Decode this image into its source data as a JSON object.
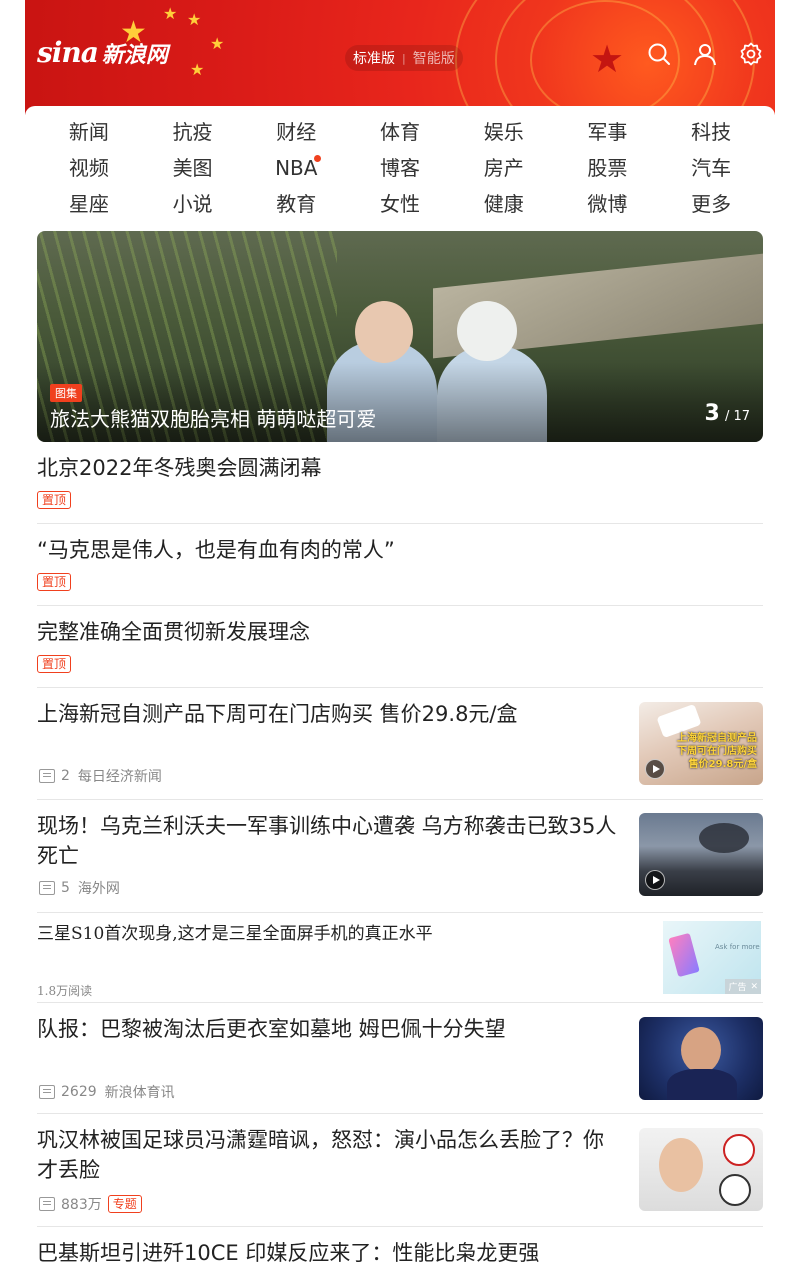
{
  "header": {
    "logo_eye": "sina",
    "logo_text": "新浪网",
    "version_standard": "标准版",
    "version_separator": "|",
    "version_smart": "智能版",
    "icons": [
      "search-icon",
      "user-icon",
      "settings-icon"
    ]
  },
  "nav": {
    "items": [
      {
        "label": "新闻"
      },
      {
        "label": "抗疫"
      },
      {
        "label": "财经"
      },
      {
        "label": "体育"
      },
      {
        "label": "娱乐"
      },
      {
        "label": "军事"
      },
      {
        "label": "科技"
      },
      {
        "label": "视频"
      },
      {
        "label": "美图"
      },
      {
        "label": "NBA",
        "dot": true
      },
      {
        "label": "博客"
      },
      {
        "label": "房产"
      },
      {
        "label": "股票"
      },
      {
        "label": "汽车"
      },
      {
        "label": "星座"
      },
      {
        "label": "小说"
      },
      {
        "label": "教育"
      },
      {
        "label": "女性"
      },
      {
        "label": "健康"
      },
      {
        "label": "微博"
      },
      {
        "label": "更多"
      }
    ]
  },
  "hero": {
    "tag": "图集",
    "caption": "旅法大熊猫双胞胎亮相 萌萌哒超可爱",
    "current": "3",
    "total": "/ 17"
  },
  "news": [
    {
      "title": "北京2022年冬残奥会圆满闭幕",
      "pin": "置顶"
    },
    {
      "title": "“马克思是伟人，也是有血有肉的常人”",
      "pin": "置顶"
    },
    {
      "title": "完整准确全面贯彻新发展理念",
      "pin": "置顶"
    },
    {
      "title": "上海新冠自测产品下周可在门店购买 售价29.8元/盒",
      "comments": "2",
      "source": "每日经济新闻",
      "thumb_text_1": "上海新冠自测产品",
      "thumb_text_2": "下周可在门店购买",
      "thumb_text_3": "售价29.8元/盒"
    },
    {
      "title": "现场！乌克兰利沃夫一军事训练中心遭袭 乌方称袭击已致35人死亡",
      "comments": "5",
      "source": "海外网"
    },
    {
      "title": "三星S10首次现身,这才是三星全面屏手机的真正水平",
      "reads": "1.8万阅读",
      "ad_label": "广告",
      "ad_close": "✕",
      "ad_img_text": "Ask for more"
    },
    {
      "title": "队报：巴黎被淘汰后更衣室如墓地 姆巴佩十分失望",
      "comments": "2629",
      "source": "新浪体育讯"
    },
    {
      "title": "巩汉林被国足球员冯潇霆暗讽，怒怼：演小品怎么丢脸了？你才丢脸",
      "comments": "883万",
      "special": "专题"
    },
    {
      "title": "巴基斯坦引进歼10CE 印媒反应来了：性能比枭龙更强"
    }
  ]
}
